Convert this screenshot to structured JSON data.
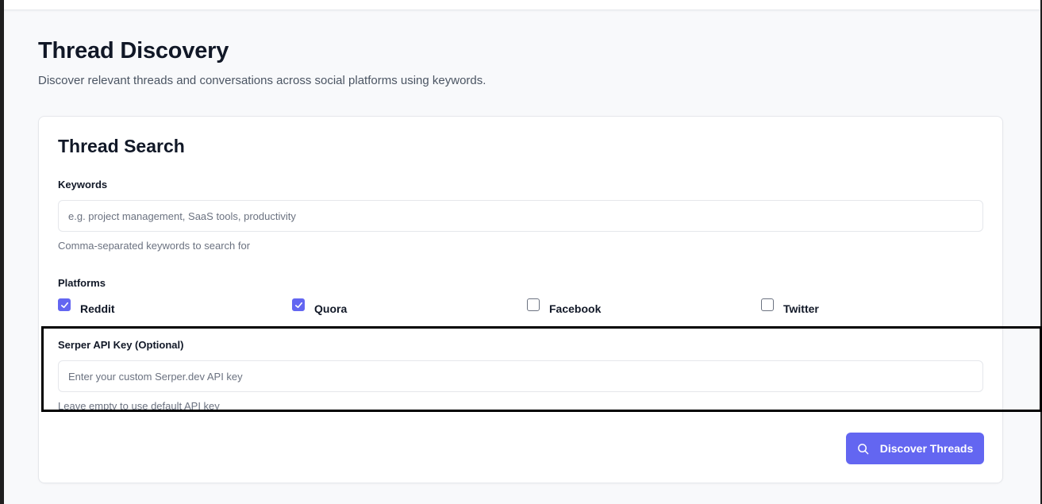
{
  "page": {
    "title": "Thread Discovery",
    "subtitle": "Discover relevant threads and conversations across social platforms using keywords."
  },
  "card": {
    "title": "Thread Search",
    "keywords": {
      "label": "Keywords",
      "placeholder": "e.g. project management, SaaS tools, productivity",
      "value": "",
      "hint": "Comma-separated keywords to search for"
    },
    "platforms": {
      "label": "Platforms",
      "items": [
        {
          "label": "Reddit",
          "checked": true
        },
        {
          "label": "Quora",
          "checked": true
        },
        {
          "label": "Facebook",
          "checked": false
        },
        {
          "label": "Twitter",
          "checked": false
        }
      ]
    },
    "api_key": {
      "label": "Serper API Key (Optional)",
      "placeholder": "Enter your custom Serper.dev API key",
      "value": "",
      "hint": "Leave empty to use default API key"
    },
    "submit_label": "Discover Threads",
    "submit_icon": "search-icon"
  },
  "colors": {
    "accent": "#6366f1",
    "background": "#f8f9fb",
    "highlight": "#000000"
  }
}
